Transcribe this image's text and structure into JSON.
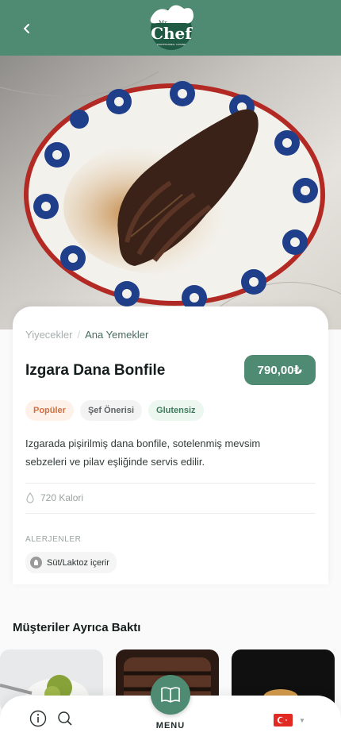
{
  "header": {
    "logo_text_small": "Mr.",
    "logo_text": "Chef",
    "logo_tagline": "PROFESSIONAL CUISINE",
    "brand_color": "#4f8a72"
  },
  "breadcrumb": {
    "parent": "Yiyecekler",
    "separator": "/",
    "current": "Ana Yemekler"
  },
  "product": {
    "title": "Izgara Dana Bonfile",
    "price": "790,00₺",
    "tags": [
      "Popüler",
      "Şef Önerisi",
      "Glutensiz"
    ],
    "description": "Izgarada pişirilmiş dana bonfile, sotelenmiş mevsim sebzeleri ve pilav eşliğinde servis edilir.",
    "calories": "720 Kalori"
  },
  "allergens": {
    "title": "ALERJENLER",
    "items": [
      "Süt/Laktoz içerir"
    ]
  },
  "also_viewed": {
    "title": "Müşteriler Ayrıca Baktı",
    "count_visible": 3
  },
  "bottom_nav": {
    "menu_label": "MENU",
    "language_flag": "TR",
    "icons": [
      "info-icon",
      "search-icon",
      "book-icon",
      "flag-icon",
      "chevron-down-icon"
    ]
  }
}
